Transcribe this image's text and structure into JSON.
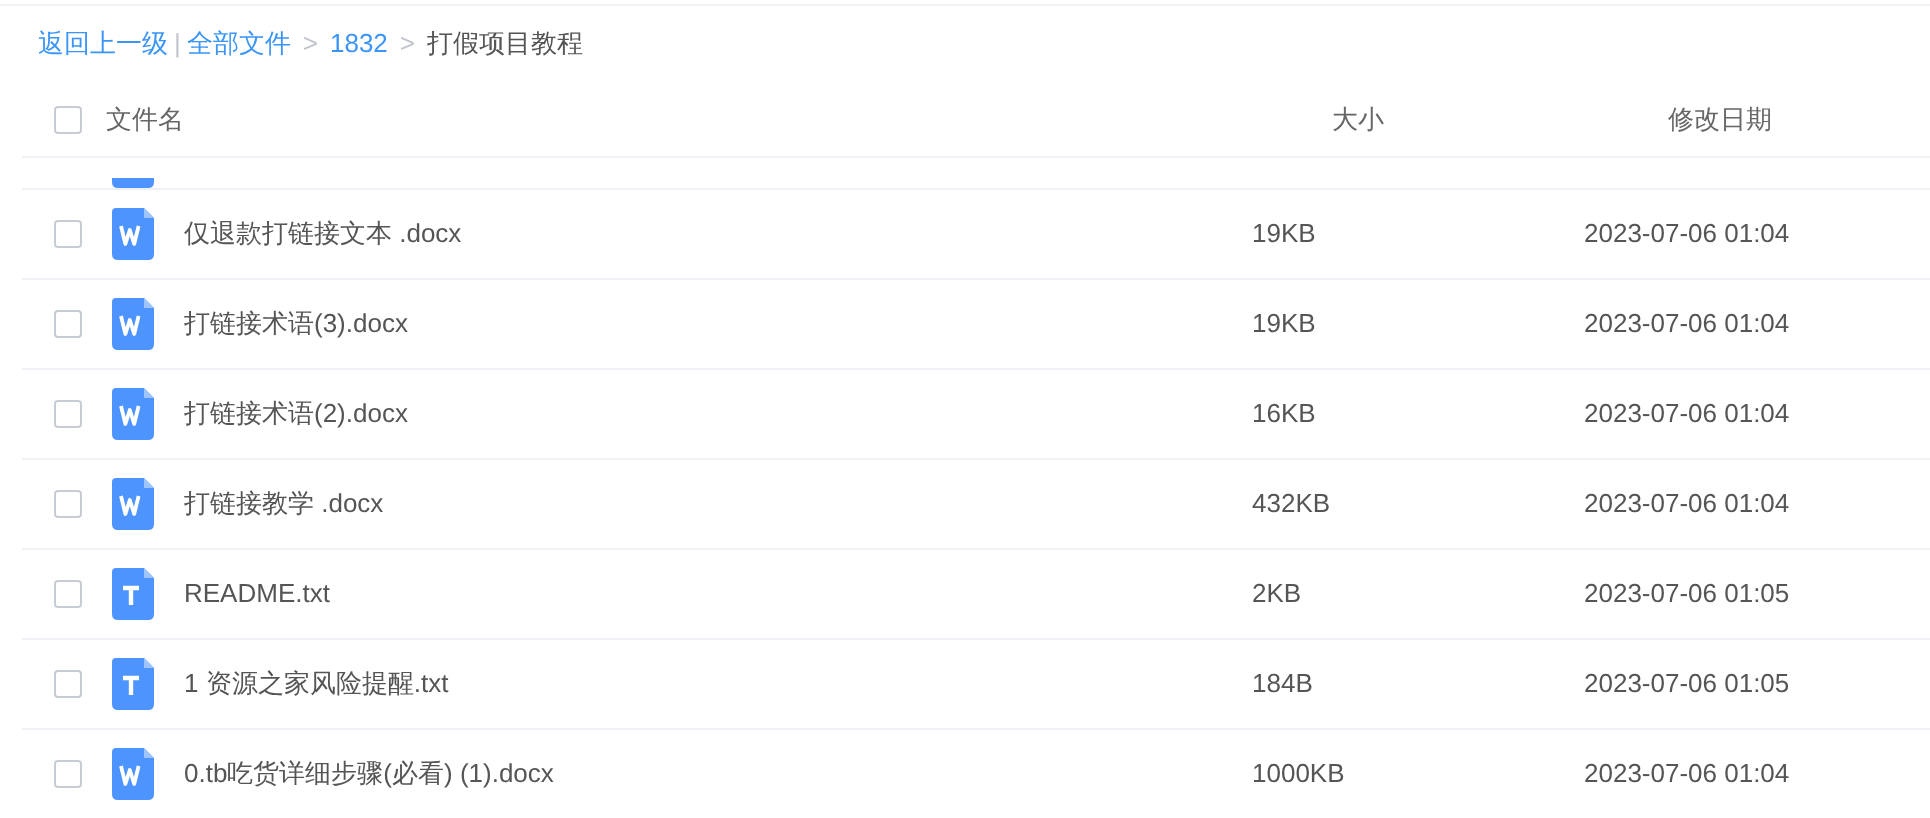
{
  "breadcrumb": {
    "back": "返回上一级",
    "separator": "|",
    "items": [
      {
        "label": "全部文件",
        "link": true
      },
      {
        "label": "1832",
        "link": true
      },
      {
        "label": "打假项目教程",
        "link": false
      }
    ],
    "arrow": ">"
  },
  "table": {
    "columns": [
      "文件名",
      "大小",
      "修改日期"
    ],
    "all_checked": false,
    "rows": [
      {
        "kind": "word",
        "name": "仅退款打链接文本 .docx",
        "size": "19KB",
        "modified": "2023-07-06 01:04",
        "checked": false
      },
      {
        "kind": "word",
        "name": "打链接术语(3).docx",
        "size": "19KB",
        "modified": "2023-07-06 01:04",
        "checked": false
      },
      {
        "kind": "word",
        "name": "打链接术语(2).docx",
        "size": "16KB",
        "modified": "2023-07-06 01:04",
        "checked": false
      },
      {
        "kind": "word",
        "name": "打链接教学 .docx",
        "size": "432KB",
        "modified": "2023-07-06 01:04",
        "checked": false
      },
      {
        "kind": "text",
        "name": "README.txt",
        "size": "2KB",
        "modified": "2023-07-06 01:05",
        "checked": false
      },
      {
        "kind": "text",
        "name": "1 资源之家风险提醒.txt",
        "size": "184B",
        "modified": "2023-07-06 01:05",
        "checked": false
      },
      {
        "kind": "word",
        "name": "0.tb吃货详细步骤(必看) (1).docx",
        "size": "1000KB",
        "modified": "2023-07-06 01:04",
        "checked": false
      }
    ]
  }
}
